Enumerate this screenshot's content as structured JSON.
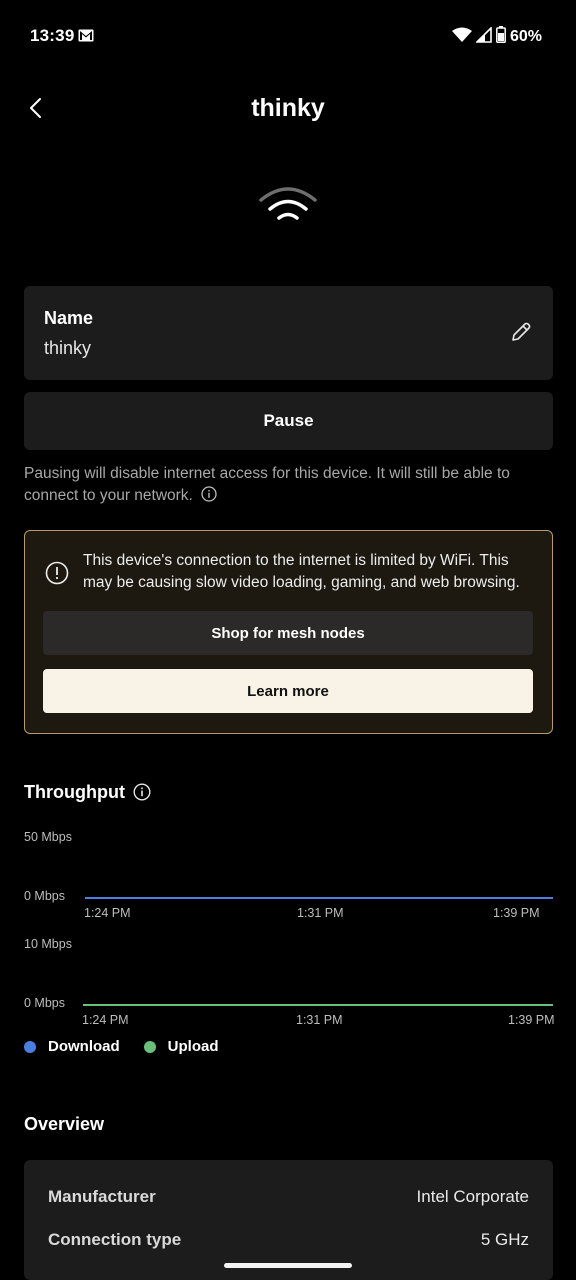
{
  "status_bar": {
    "time": "13:39",
    "battery": "60%"
  },
  "header": {
    "title": "thinky"
  },
  "name_card": {
    "label": "Name",
    "value": "thinky"
  },
  "pause": {
    "button_label": "Pause",
    "note": "Pausing will disable internet access for this device. It will still be able to connect to your network."
  },
  "warning": {
    "message": "This device's connection to the internet is limited by WiFi. This may be causing slow video loading, gaming, and web browsing.",
    "shop_label": "Shop for mesh nodes",
    "learn_label": "Learn more"
  },
  "throughput": {
    "title": "Throughput",
    "download_chart": {
      "max_label": "50 Mbps",
      "min_label": "0 Mbps",
      "times": [
        "1:24 PM",
        "1:31 PM",
        "1:39 PM"
      ]
    },
    "upload_chart": {
      "max_label": "10 Mbps",
      "min_label": "0 Mbps",
      "times": [
        "1:24 PM",
        "1:31 PM",
        "1:39 PM"
      ]
    },
    "legend": {
      "download": "Download",
      "upload": "Upload"
    },
    "colors": {
      "download": "#4a7fe0",
      "upload": "#6ac07a"
    }
  },
  "overview": {
    "title": "Overview",
    "rows": [
      {
        "key": "Manufacturer",
        "value": "Intel Corporate"
      },
      {
        "key": "Connection type",
        "value": "5 GHz"
      }
    ]
  }
}
